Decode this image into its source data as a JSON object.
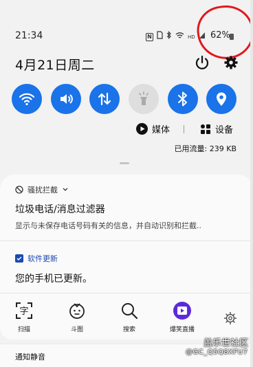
{
  "status_bar": {
    "time": "21:34",
    "battery_percent": "62%",
    "icons": [
      "nfc-icon",
      "sim-icon",
      "bluetooth-icon",
      "wifi-icon",
      "hd-signal-icon",
      "signal-icon"
    ],
    "hd_label": "HD"
  },
  "header": {
    "date": "4月21日周二"
  },
  "quick_toggles": [
    {
      "name": "wifi",
      "on": true
    },
    {
      "name": "sound",
      "on": true
    },
    {
      "name": "mobile-data",
      "on": true
    },
    {
      "name": "flashlight",
      "on": false
    },
    {
      "name": "bluetooth",
      "on": true
    },
    {
      "name": "location",
      "on": true
    }
  ],
  "media": {
    "media_label": "媒体",
    "devices_label": "设备"
  },
  "data_usage": "已用流量: 239 KB",
  "notifications": [
    {
      "app": "骚扰拦截",
      "title": "垃圾电话/消息过滤器",
      "body": "显示与未保存电话号码有关的信息，并自动识别和拦截.."
    },
    {
      "app": "软件更新",
      "title": "您的手机已更新。"
    }
  ],
  "shortcuts": [
    {
      "label": "扫描",
      "icon": "scan-text-icon"
    },
    {
      "label": "斗图",
      "icon": "meme-face-icon"
    },
    {
      "label": "搜索",
      "icon": "search-icon"
    },
    {
      "label": "爆笑直播",
      "icon": "live-video-icon"
    }
  ],
  "scan_glyph": "字",
  "silent_notifications": "通知静音",
  "watermark": {
    "line1": "盖乐世社区",
    "line2": "@GC_Q5Q8XFU7"
  },
  "colors": {
    "accent": "#1a73e8",
    "highlight": "#e0191d"
  }
}
